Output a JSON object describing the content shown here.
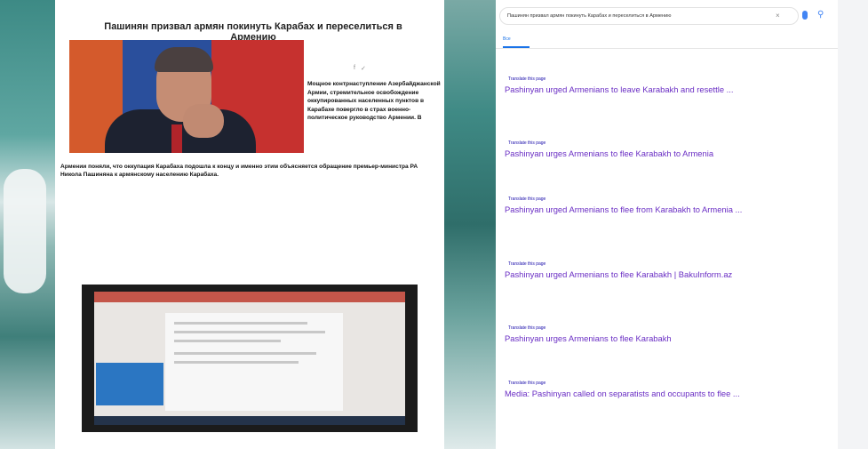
{
  "article": {
    "headline": "Пашинян призвал армян покинуть Карабах и переселиться в Армению",
    "meta": "",
    "share": [
      "",
      "f",
      "✓"
    ],
    "side_text": "Мощное контрнаступление Азербайджанской Армии, стремительное освобождение оккупированных населенных пунктов в Карабахе повергло в страх военно-политическое руководство Армении. В",
    "full_text": "Армении поняли, что оккупация Карабаха подошла к концу и именно этим объясняется обращение премьер-министра РА Никола Пашиняна к армянскому населению Карабаха.",
    "p1": "",
    "p2": ""
  },
  "serp": {
    "query": "Пашинян призвал армян покинуть Карабах и переселиться в Армению",
    "tabs": [
      "Все",
      "",
      "",
      "",
      "",
      ""
    ],
    "tabs_right": [
      "",
      ""
    ],
    "stats": "",
    "results": [
      {
        "url": "",
        "translate": "Translate this page",
        "title": "Pashinyan urged Armenians to leave Karabakh and resettle ...",
        "snippet": ""
      },
      {
        "url": "",
        "translate": "Translate this page",
        "title": "Pashinyan urges Armenians to flee Karabakh to Armenia",
        "snippet": ""
      },
      {
        "url": "",
        "translate": "Translate this page",
        "title": "Pashinyan urged Armenians to flee from Karabakh to Armenia ...",
        "snippet": ""
      },
      {
        "url": "",
        "translate": "Translate this page",
        "title": "Pashinyan urged Armenians to flee Karabakh | BakuInform.az",
        "snippet": ""
      },
      {
        "url": "",
        "translate": "Translate this page",
        "title": "Pashinyan urges Armenians to flee Karabakh",
        "snippet": ""
      },
      {
        "url": "",
        "translate": "Translate this page",
        "title": "Media: Pashinyan called on separatists and occupants to flee ...",
        "snippet": ""
      }
    ]
  }
}
